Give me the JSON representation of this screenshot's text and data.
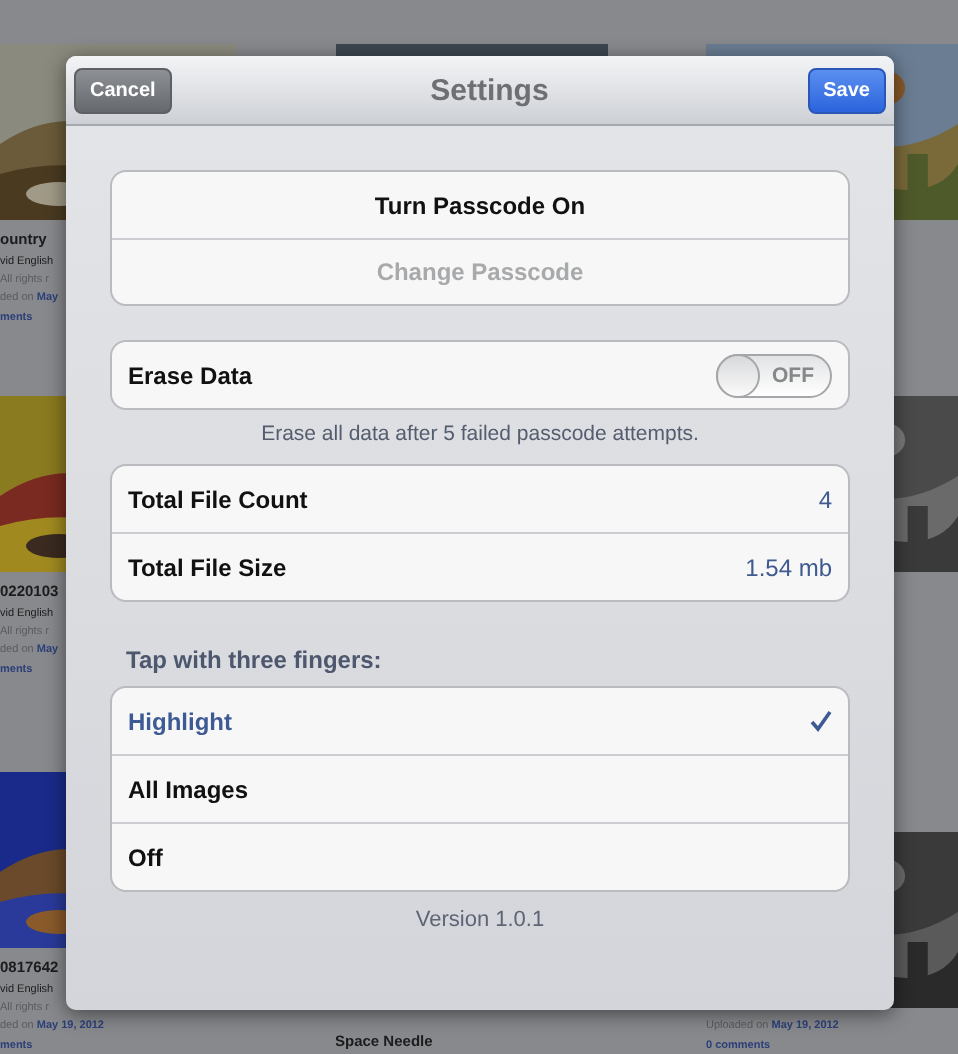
{
  "background": {
    "tiles": [
      {
        "kind": "picture",
        "captions": [
          {
            "kind": "title",
            "text": "ountry"
          },
          {
            "kind": "author",
            "text": "vid English"
          },
          {
            "kind": "meta",
            "text": "All rights r"
          },
          {
            "kind": "uploaded",
            "text": "ded on",
            "date": "May"
          },
          {
            "kind": "link",
            "text": "ments"
          }
        ]
      },
      {
        "kind": "picture"
      },
      {
        "kind": "picture"
      },
      {
        "kind": "picture",
        "captions": [
          {
            "kind": "title",
            "text": "0220103"
          },
          {
            "kind": "author",
            "text": "vid English"
          },
          {
            "kind": "meta",
            "text": "All rights r"
          },
          {
            "kind": "uploaded",
            "text": "ded on",
            "date": "May"
          },
          {
            "kind": "link",
            "text": "ments"
          }
        ]
      },
      {
        "kind": "blank"
      },
      {
        "kind": "picture"
      },
      {
        "kind": "picture",
        "captions": [
          {
            "kind": "title",
            "text": "0817642"
          },
          {
            "kind": "author",
            "text": "vid English"
          },
          {
            "kind": "meta",
            "text": "All rights r"
          },
          {
            "kind": "uploaded",
            "text": "ded on",
            "date": "May 19, 2012"
          },
          {
            "kind": "link",
            "text": "ments"
          }
        ]
      },
      {
        "kind": "blank",
        "captions": [
          {
            "kind": "title",
            "text": "Space Needle"
          }
        ]
      },
      {
        "kind": "picture",
        "captions": [
          {
            "kind": "uploaded",
            "text": "Uploaded on",
            "date": "May 19, 2012"
          },
          {
            "kind": "link",
            "text": "0 comments"
          }
        ]
      }
    ]
  },
  "dialog": {
    "title": "Settings",
    "cancel": "Cancel",
    "save": "Save",
    "passcode": [
      {
        "label": "Turn Passcode On",
        "disabled": false
      },
      {
        "label": "Change Passcode",
        "disabled": true
      }
    ],
    "erase": {
      "label": "Erase Data",
      "on": false,
      "switch_label": "OFF",
      "note": "Erase all data after 5 failed passcode attempts."
    },
    "stats": [
      {
        "label": "Total File Count",
        "value": "4"
      },
      {
        "label": "Total File Size",
        "value": "1.54 mb"
      }
    ],
    "tap_header": "Tap with three fingers:",
    "tap_options": [
      {
        "label": "Highlight",
        "selected": true
      },
      {
        "label": "All Images",
        "selected": false
      },
      {
        "label": "Off",
        "selected": false
      }
    ],
    "version": "Version 1.0.1"
  }
}
